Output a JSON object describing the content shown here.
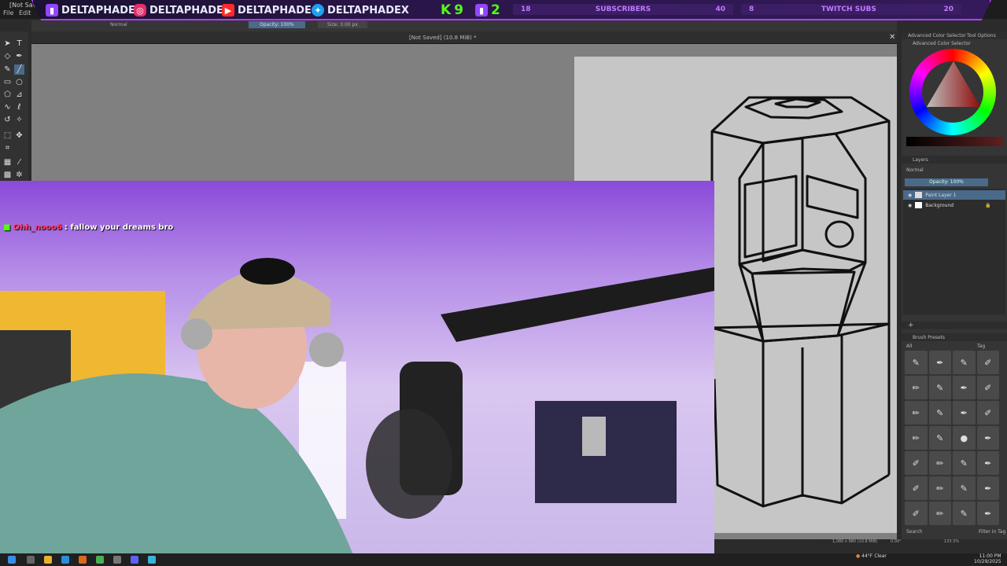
{
  "window": {
    "title": "[Not Saved]",
    "menu": [
      "File",
      "Edit"
    ]
  },
  "overlay": {
    "handles": [
      {
        "icon": "twitch-icon",
        "name": "DELTAPHADE",
        "color": "#9146ff"
      },
      {
        "icon": "instagram-icon",
        "name": "DELTAPHADE",
        "color": "#e1306c"
      },
      {
        "icon": "youtube-icon",
        "name": "DELTAPHADE",
        "color": "#ff2a2a"
      },
      {
        "icon": "twitter-icon",
        "name": "DELTAPHADEX",
        "color": "#1da1f2"
      }
    ],
    "counters": [
      {
        "icon": "kick-icon",
        "value": "9",
        "color": "#53fc18"
      },
      {
        "icon": "twitch-icon",
        "value": "2",
        "color": "#9146ff"
      }
    ],
    "goals": [
      {
        "start": "18",
        "label": "SUBSCRIBERS",
        "end": "40",
        "progress": 0.0
      },
      {
        "start": "8",
        "label": "TWITCH SUBS",
        "end": "20",
        "progress": 0.0
      }
    ]
  },
  "tool_options": {
    "blend": "Normal",
    "opacity": "Opacity: 100%",
    "size": "Size: 3.00 px"
  },
  "document": {
    "title": "[Not Saved]  (10.8 MiB) *"
  },
  "chat": {
    "user": "Ohh_nooo6",
    "message": ": fallow your dreams bro"
  },
  "right_panel": {
    "color_tab": "Advanced Color Selector",
    "tool_options_tab": "Tool Options",
    "color_title": "Advanced Color Selector",
    "layers_title": "Layers",
    "blend_mode": "Normal",
    "opacity": "Opacity:  100%",
    "layers": [
      {
        "name": "Paint Layer 1",
        "selected": true
      },
      {
        "name": "Background",
        "selected": false
      }
    ],
    "brush_title": "Brush Presets",
    "brush_filter": "All",
    "brush_tag": "Tag",
    "search_placeholder": "Search",
    "filter_in_tag": "Filter in Tag"
  },
  "statusbar": {
    "dims": "1,080 x 980 (10.8 MiB)",
    "angle": "0.00°",
    "zoom": "133.3%"
  },
  "taskbar": {
    "temp": "44°F",
    "weather": "Clear",
    "time": "11:00 PM",
    "date": "10/29/2025"
  }
}
